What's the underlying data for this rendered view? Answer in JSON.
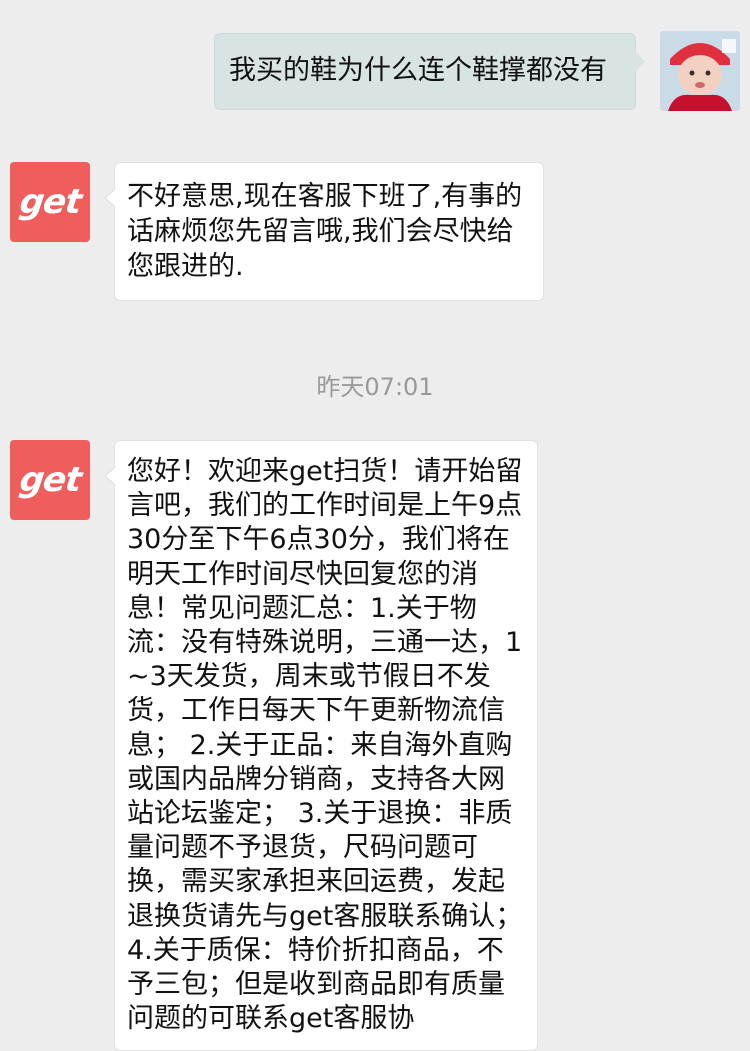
{
  "messages": [
    {
      "sender": "user",
      "avatar_icon": "user-avatar-photo",
      "text": "我买的鞋为什么连个鞋撑都没有"
    },
    {
      "sender": "get",
      "avatar_label": "get",
      "avatar_icon": "get-logo-icon",
      "text": "不好意思,现在客服下班了,有事的话麻烦您先留言哦,我们会尽快给您跟进的."
    },
    {
      "sender": "get",
      "avatar_label": "get",
      "avatar_icon": "get-logo-icon",
      "text": "您好！欢迎来get扫货！请开始留言吧，我们的工作时间是上午9点30分至下午6点30分，我们将在明天工作时间尽快回复您的消息！常见问题汇总：1.关于物流：没有特殊说明，三通一达，1~3天发货，周末或节假日不发货，工作日每天下午更新物流信息； 2.关于正品：来自海外直购或国内品牌分销商，支持各大网站论坛鉴定； 3.关于退换：非质量问题不予退货，尺码问题可换，需买家承担来回运费，发起退换货请先与get客服联系确认； 4.关于质保：特价折扣商品，不予三包；但是收到商品即有质量问题的可联系get客服协"
    }
  ],
  "timestamp": "昨天07:01",
  "colors": {
    "background": "#ededed",
    "user_bubble": "#d8e3e3",
    "agent_bubble": "#ffffff",
    "get_logo": "#ef5d5d",
    "timestamp_text": "#999999"
  }
}
